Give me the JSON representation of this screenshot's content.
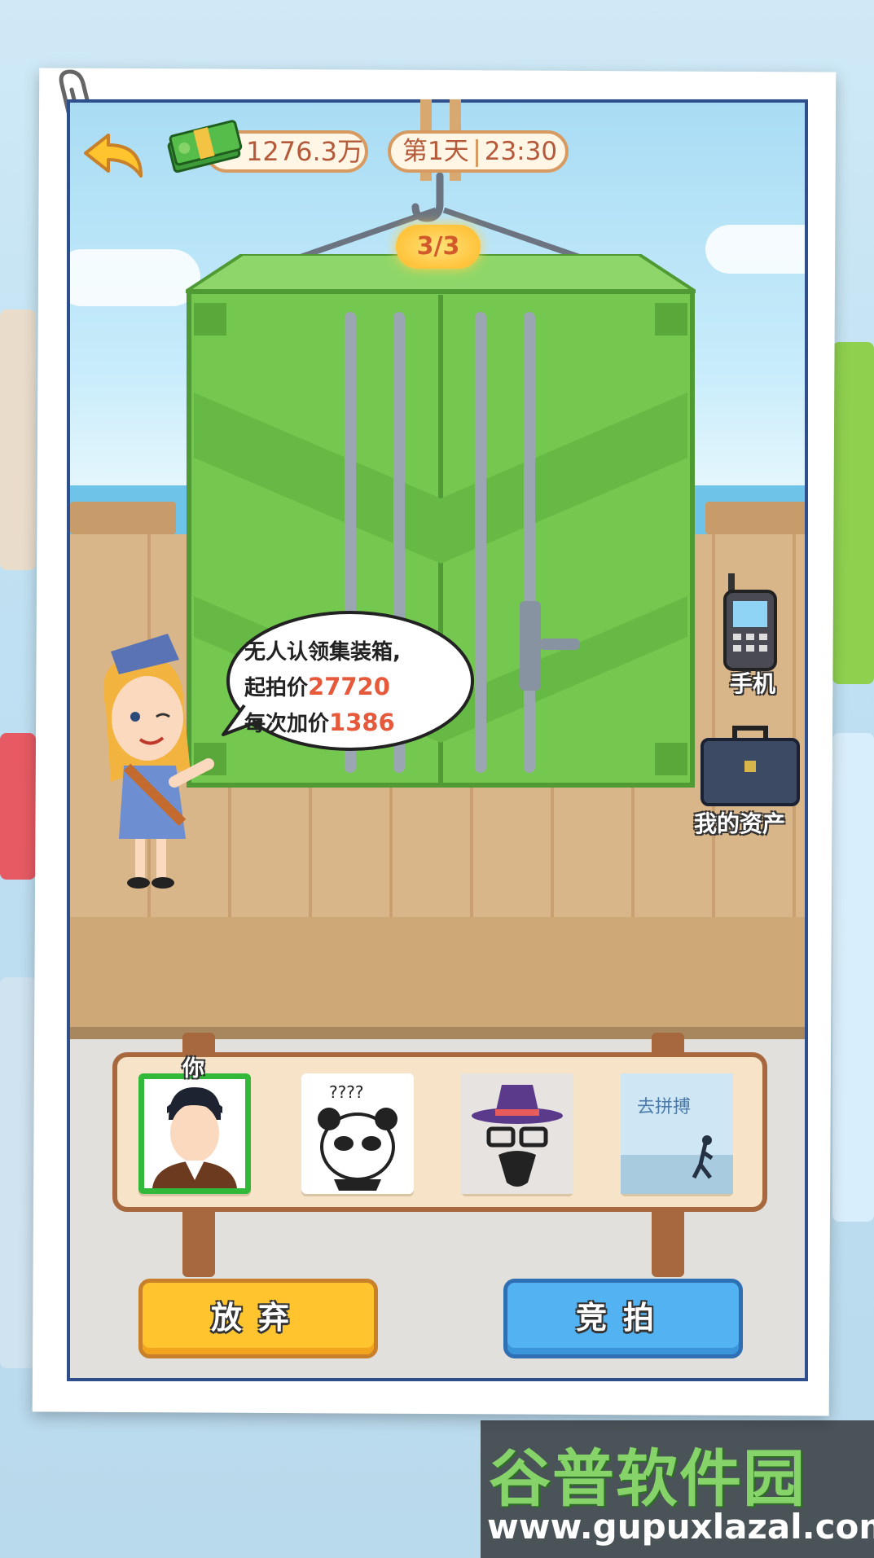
{
  "hud": {
    "money": "1276.3万",
    "day": "第1天",
    "time": "23:30"
  },
  "container": {
    "counter": "3/3",
    "color": "#74c84f"
  },
  "speech": {
    "line1": "无人认领集装箱,",
    "start_label": "起拍价",
    "start_price": "27720",
    "increment_label": "每次加价",
    "increment": "1386"
  },
  "side": {
    "phone_label": "手机",
    "assets_label": "我的资产"
  },
  "players": {
    "you_label": "你",
    "slots": [
      {
        "icon": "player-avatar-man",
        "selected": true
      },
      {
        "icon": "panda-meme-avatar",
        "text": "????"
      },
      {
        "icon": "hat-glasses-avatar"
      },
      {
        "icon": "seaside-photo-avatar",
        "text": "去拼搏"
      }
    ]
  },
  "actions": {
    "give_up": "放弃",
    "bid": "竞拍"
  },
  "watermark": {
    "title": "谷普软件园",
    "url": "www.gupuxlazal.com"
  },
  "colors": {
    "accent_yellow": "#ffc42e",
    "accent_blue": "#53b2f2",
    "price_red": "#e6593a",
    "frame_blue": "#2f4e8c"
  }
}
